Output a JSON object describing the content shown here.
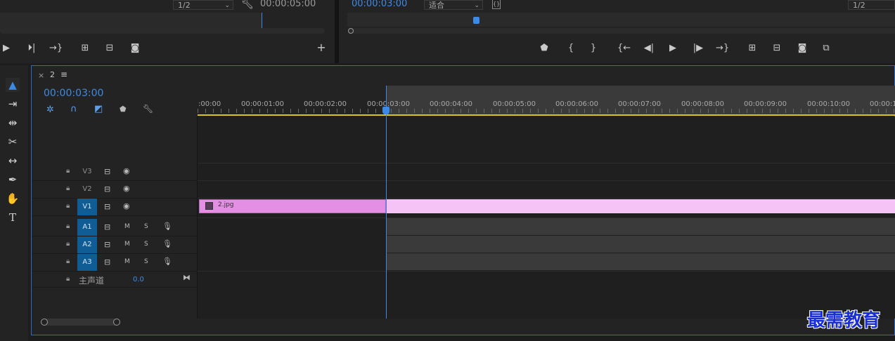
{
  "source_monitor": {
    "resolution_value": "1/2",
    "timecode": "00:00:05:00",
    "add_label": "+"
  },
  "program_monitor": {
    "timecode": "00:00:03:00",
    "fit_value": "适合",
    "resolution_value": "1/2"
  },
  "timeline": {
    "tab_close": "×",
    "sequence_name": "2",
    "menu_glyph": "≡",
    "timecode": "00:00:03:00",
    "ruler_labels": [
      ":00:00",
      "00:00:01:00",
      "00:00:02:00",
      "00:00:03:00",
      "00:00:04:00",
      "00:00:05:00",
      "00:00:06:00",
      "00:00:07:00",
      "00:00:08:00",
      "00:00:09:00",
      "00:00:10:00",
      "00:00:1"
    ],
    "video_tracks": [
      "V3",
      "V2",
      "V1"
    ],
    "audio_tracks": [
      "A1",
      "A2",
      "A3"
    ],
    "mute_label": "M",
    "solo_label": "S",
    "master_label": "主声道",
    "master_value": "0.0",
    "clip_name": "2.jpg"
  },
  "watermark": "最需教育"
}
